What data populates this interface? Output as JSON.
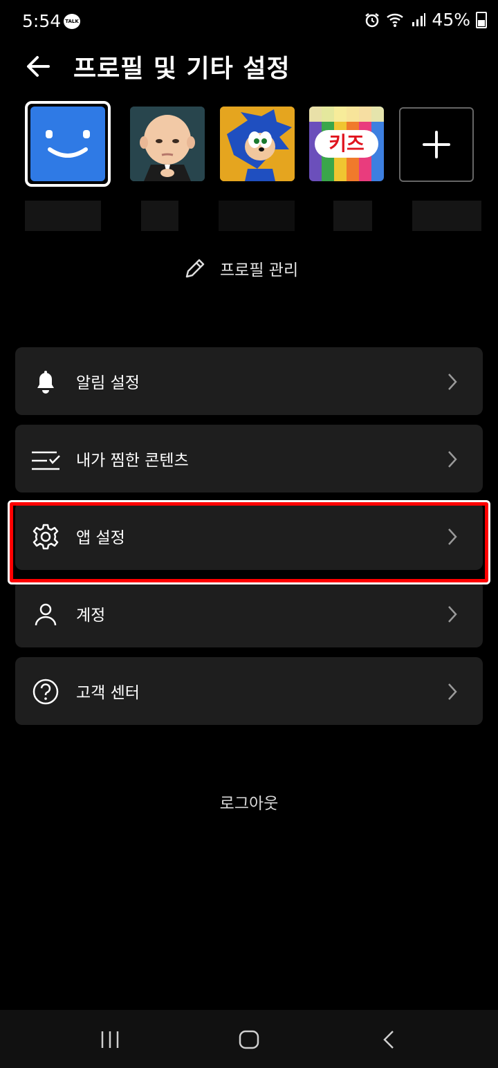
{
  "status_bar": {
    "time": "5:54",
    "talk_badge": "TALK",
    "battery": "45%"
  },
  "header": {
    "title": "프로필 및 기타 설정"
  },
  "profiles": [
    {
      "name": "main-profile",
      "icon": "smiley-icon",
      "selected": true
    },
    {
      "name": "boss-baby-profile",
      "icon": "boss-baby-avatar"
    },
    {
      "name": "sonic-profile",
      "icon": "sonic-avatar"
    },
    {
      "name": "kids-profile",
      "icon": "kids-avatar",
      "badge_text": "키즈"
    },
    {
      "name": "add-profile",
      "icon": "plus-icon"
    }
  ],
  "manage_profiles": {
    "label": "프로필 관리"
  },
  "menu": [
    {
      "label": "알림 설정",
      "icon": "bell-icon"
    },
    {
      "label": "내가 찜한 콘텐츠",
      "icon": "list-check-icon"
    },
    {
      "label": "앱 설정",
      "icon": "gear-icon",
      "highlighted": true
    },
    {
      "label": "계정",
      "icon": "user-icon"
    },
    {
      "label": "고객 센터",
      "icon": "help-circle-icon"
    }
  ],
  "logout": {
    "label": "로그아웃"
  },
  "colors": {
    "highlight": "#ff0000",
    "card": "#1e1e1e",
    "profile_blue": "#2f7ae5"
  }
}
